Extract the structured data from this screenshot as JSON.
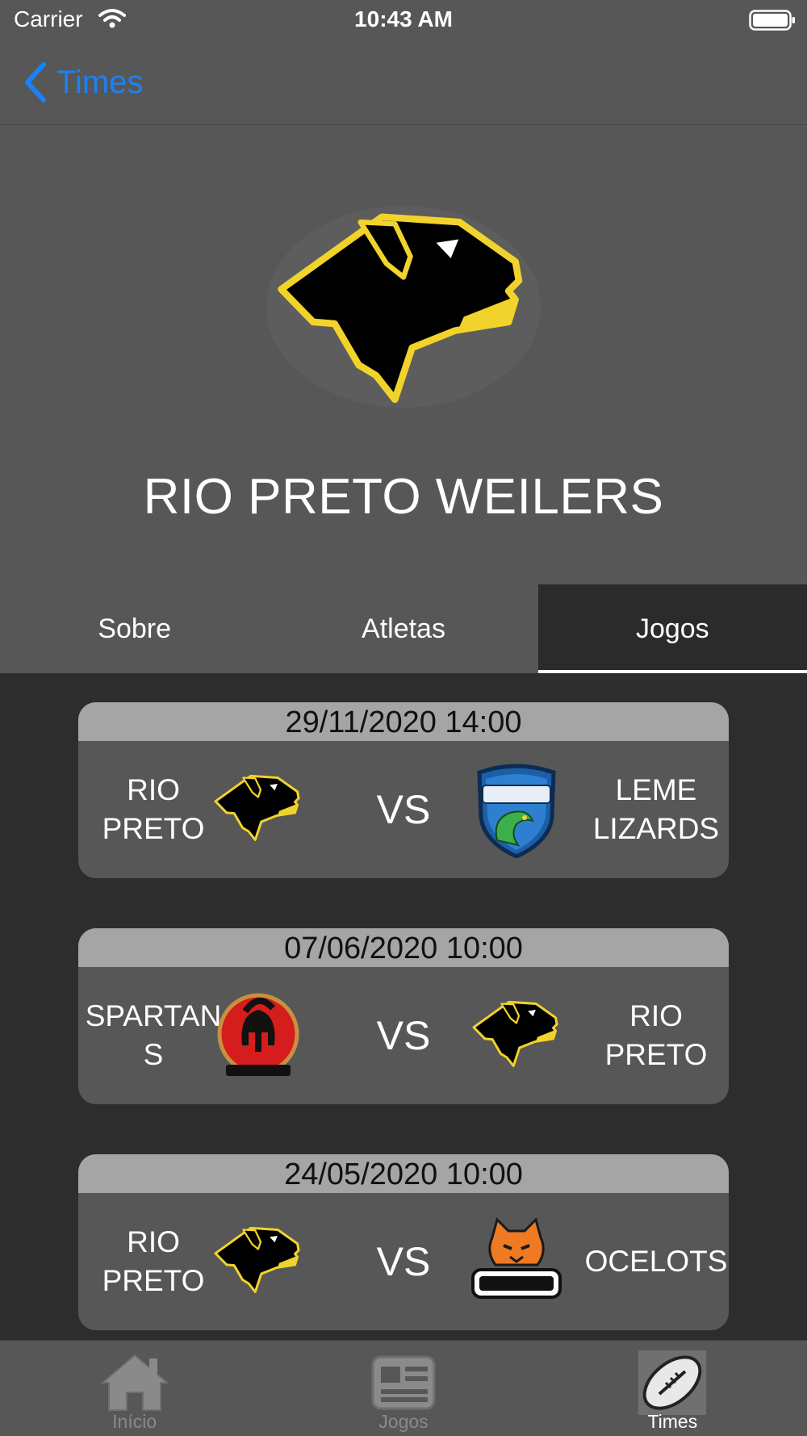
{
  "status_bar": {
    "carrier": "Carrier",
    "time": "10:43 AM"
  },
  "nav": {
    "back_label": "Times"
  },
  "team": {
    "name": "RIO PRETO WEILERS"
  },
  "tabs": [
    {
      "label": "Sobre",
      "active": false
    },
    {
      "label": "Atletas",
      "active": false
    },
    {
      "label": "Jogos",
      "active": true
    }
  ],
  "games": [
    {
      "datetime": "29/11/2020 14:00",
      "home": "RIO\nPRETO",
      "home_logo": "rottweiler-logo",
      "vs": "VS",
      "away": "LEME\nLIZARDS",
      "away_logo": "lizards-logo"
    },
    {
      "datetime": "07/06/2020 10:00",
      "home": "SPARTAN\nS",
      "home_logo": "spartans-logo",
      "vs": "VS",
      "away": "RIO\nPRETO",
      "away_logo": "rottweiler-logo"
    },
    {
      "datetime": "24/05/2020 10:00",
      "home": "RIO\nPRETO",
      "home_logo": "rottweiler-logo",
      "vs": "VS",
      "away": "OCELOTS",
      "away_logo": "ocelots-logo"
    }
  ],
  "tab_bar": [
    {
      "label": "Início",
      "icon": "home-icon",
      "active": false
    },
    {
      "label": "Jogos",
      "icon": "newspaper-icon",
      "active": false
    },
    {
      "label": "Times",
      "icon": "football-icon",
      "active": true
    }
  ],
  "colors": {
    "accent": "#1a82f7",
    "header_bg": "#575757",
    "list_bg": "#2d2d2d",
    "date_strip": "#a5a5a5",
    "logo_yellow": "#f2d32b"
  }
}
